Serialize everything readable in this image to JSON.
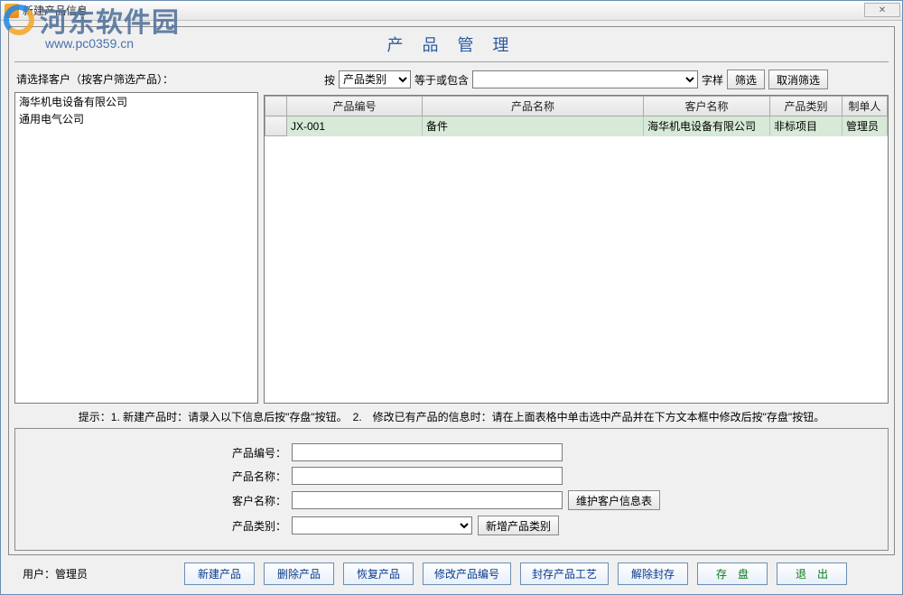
{
  "window": {
    "title": "新建产品信息",
    "close_glyph": "✕"
  },
  "watermark": {
    "text": "河东软件园",
    "url": "www.pc0359.cn"
  },
  "page_title": "产 品 管 理",
  "left": {
    "label": "请选择客户（按客户筛选产品）：",
    "items": [
      "海华机电设备有限公司",
      "通用电气公司"
    ]
  },
  "filter": {
    "prefix": "按",
    "field_options": [
      "产品类别"
    ],
    "field_value": "产品类别",
    "op_label": "等于或包含",
    "value": "",
    "suffix": "字样",
    "btn_filter": "筛选",
    "btn_clear": "取消筛选"
  },
  "table": {
    "columns": [
      "产品编号",
      "产品名称",
      "客户名称",
      "产品类别",
      "制单人"
    ],
    "rows": [
      {
        "code": "JX-001",
        "name": "备件",
        "customer": "海华机电设备有限公司",
        "category": "非标项目",
        "creator": "管理员"
      }
    ]
  },
  "hint": "提示：1. 新建产品时：请录入以下信息后按\"存盘\"按钮。　2.　修改已有产品的信息时：请在上面表格中单击选中产品并在下方文本框中修改后按\"存盘\"按钮。",
  "form": {
    "code_label": "产品编号：",
    "name_label": "产品名称：",
    "customer_label": "客户名称：",
    "category_label": "产品类别：",
    "btn_customer_maint": "维护客户信息表",
    "btn_add_category": "新增产品类别",
    "code_value": "",
    "name_value": "",
    "customer_value": "",
    "category_value": ""
  },
  "bottom": {
    "user_label": "用户：管理员",
    "btn_new": "新建产品",
    "btn_delete": "删除产品",
    "btn_restore": "恢复产品",
    "btn_edit_code": "修改产品编号",
    "btn_seal": "封存产品工艺",
    "btn_unseal": "解除封存",
    "btn_save": "存　盘",
    "btn_exit": "退　出"
  }
}
